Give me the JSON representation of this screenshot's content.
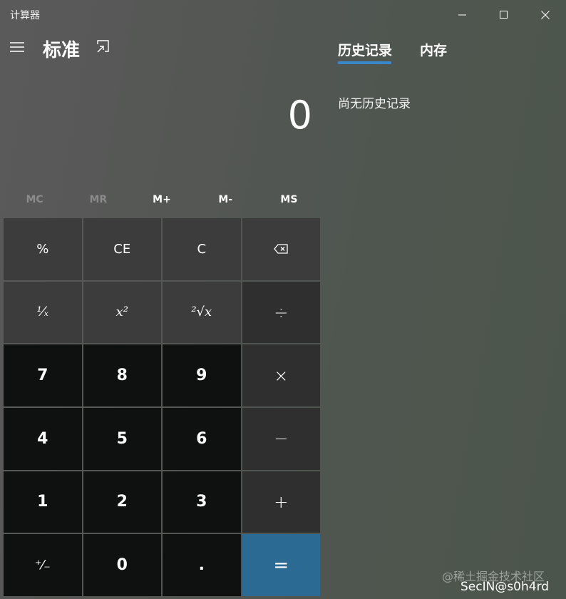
{
  "window": {
    "title": "计算器",
    "controls": {
      "minimize_icon": "minimize-icon",
      "maximize_icon": "maximize-icon",
      "close_icon": "close-icon"
    }
  },
  "header": {
    "menu_icon": "hamburger-icon",
    "mode": "标准",
    "keep_on_top_icon": "keep-on-top-icon"
  },
  "display": {
    "value": "0"
  },
  "memory_buttons": [
    {
      "label": "MC",
      "enabled": false
    },
    {
      "label": "MR",
      "enabled": false
    },
    {
      "label": "M+",
      "enabled": true
    },
    {
      "label": "M-",
      "enabled": true
    },
    {
      "label": "MS",
      "enabled": true
    }
  ],
  "keys": [
    {
      "label": "%",
      "kind": "fn"
    },
    {
      "label": "CE",
      "kind": "fn"
    },
    {
      "label": "C",
      "kind": "fn"
    },
    {
      "label": "⌫",
      "kind": "fn",
      "icon": "backspace-icon"
    },
    {
      "label": "¹⁄ₓ",
      "kind": "fn"
    },
    {
      "label": "x²",
      "kind": "fn"
    },
    {
      "label": "²√x",
      "kind": "fn"
    },
    {
      "label": "÷",
      "kind": "op"
    },
    {
      "label": "7",
      "kind": "num"
    },
    {
      "label": "8",
      "kind": "num"
    },
    {
      "label": "9",
      "kind": "num"
    },
    {
      "label": "×",
      "kind": "op"
    },
    {
      "label": "4",
      "kind": "num"
    },
    {
      "label": "5",
      "kind": "num"
    },
    {
      "label": "6",
      "kind": "num"
    },
    {
      "label": "−",
      "kind": "op"
    },
    {
      "label": "1",
      "kind": "num"
    },
    {
      "label": "2",
      "kind": "num"
    },
    {
      "label": "3",
      "kind": "num"
    },
    {
      "label": "+",
      "kind": "op"
    },
    {
      "label": "⁺⁄₋",
      "kind": "num"
    },
    {
      "label": "0",
      "kind": "num"
    },
    {
      "label": ".",
      "kind": "num"
    },
    {
      "label": "=",
      "kind": "eq"
    }
  ],
  "side_panel": {
    "tabs": [
      {
        "label": "历史记录",
        "active": true
      },
      {
        "label": "内存",
        "active": false
      }
    ],
    "empty_message": "尚无历史记录"
  },
  "watermark": {
    "line1": "@稀土掘金技术社区",
    "line2": "SecIN@s0h4rd"
  },
  "colors": {
    "accent": "#3a86c8",
    "equals_key": "#2b6a93"
  }
}
